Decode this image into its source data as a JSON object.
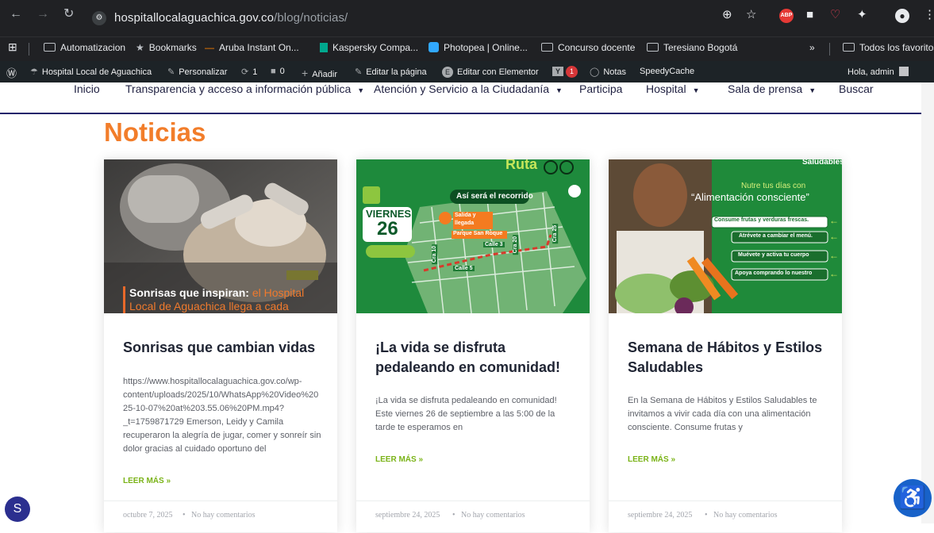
{
  "browser": {
    "url_domain": "hospitallocalaguachica.gov.co",
    "url_path": "/blog/noticias/",
    "back_glyph": "←",
    "forward_glyph": "→",
    "reload_glyph": "↻",
    "site_info_glyph": "⚙",
    "zoom_glyph": "⊕",
    "star_glyph": "☆",
    "abp_label": "ABP",
    "ext1_glyph": "■",
    "pocket_glyph": "♡",
    "puzzle_glyph": "✦",
    "profile_glyph": "●",
    "menu_glyph": "⋮"
  },
  "bookmarks": {
    "apps_glyph": "⊞",
    "items": [
      {
        "label": "Automatizacion"
      },
      {
        "label": "Bookmarks",
        "glyph": "★"
      },
      {
        "label": "Aruba Instant On...",
        "glyph": "—"
      },
      {
        "label": "Kaspersky Compa..."
      },
      {
        "label": "Photopea | Online..."
      },
      {
        "label": "Concurso docente"
      },
      {
        "label": "Teresiano Bogotá"
      }
    ],
    "overflow_glyph": "»",
    "all_label": "Todos los favoritos"
  },
  "wp_admin": {
    "wp_glyph": "Ⓦ",
    "site_glyph": "☂",
    "site_name": "Hospital Local de Aguachica",
    "customize_glyph": "✎",
    "customize": "Personalizar",
    "updates_glyph": "⟳",
    "updates_count": "1",
    "comments_glyph": "■",
    "comments_count": "0",
    "add_glyph": "+",
    "add": "Añadir",
    "edit_glyph": "✎",
    "edit_page": "Editar la página",
    "elementor_glyph": "E",
    "elementor": "Editar con Elementor",
    "yoast_glyph": "Y",
    "yoast_count": "1",
    "notes_glyph": "◯",
    "notes": "Notas",
    "speedy": "SpeedyCache",
    "greeting": "Hola, admin"
  },
  "site_nav": {
    "caret": "▼",
    "items": [
      {
        "label": "Inicio"
      },
      {
        "label": "Transparencia y acceso a información pública"
      },
      {
        "label": "Atención y Servicio a la Ciudadanía"
      },
      {
        "label": "Participa"
      },
      {
        "label": "Hospital"
      },
      {
        "label": "Sala de prensa"
      },
      {
        "label": "Buscar"
      }
    ]
  },
  "page": {
    "title": "Noticias"
  },
  "posts": [
    {
      "title": "Sonrisas que cambian vidas",
      "excerpt": "https://www.hospitallocalaguachica.gov.co/wp-content/uploads/2025/10/WhatsApp%20Video%2025-10-07%20at%203.55.06%20PM.mp4?_t=1759871729 Emerson, Leidy y Camila recuperaron la alegría de jugar, comer y sonreír sin dolor gracias al cuidado oportuno del",
      "read_more": "LEER MÁS »",
      "date": "octubre 7, 2025",
      "comments": "No hay comentarios",
      "thumb_caption_bold": "Sonrisas que inspiran:",
      "thumb_caption_rest": " el Hospital Local de Aguachica llega a cada"
    },
    {
      "title": "¡La vida se disfruta pedaleando en comunidad!",
      "excerpt": "¡La vida se disfruta pedaleando en comunidad! Este viernes 26 de septiembre a las 5:00 de la tarde te esperamos en",
      "read_more": "LEER MÁS »",
      "date": "septiembre 24, 2025",
      "comments": "No hay comentarios",
      "poster": {
        "brand": "Ruta",
        "route_title": "Así será el recorrido",
        "day": "VIERNES",
        "day_num": "26",
        "start": "Salida y llegada",
        "start_place": "Parque San Roque",
        "streets": [
          "Calle 3",
          "Calle 5",
          "Cra 10",
          "Cra 20",
          "Cra 25"
        ]
      }
    },
    {
      "title": "Semana de Hábitos y Estilos Saludables",
      "excerpt": "En la Semana de Hábitos y Estilos Saludables te invitamos a vivir cada día con una alimentación consciente.  Consume frutas y",
      "read_more": "LEER MÁS »",
      "date": "septiembre 24, 2025",
      "comments": "No hay comentarios",
      "poster": {
        "corner": "Saludables",
        "line1": "Nutre tus días con",
        "line2": "“Alimentación consciente”",
        "tips": [
          "Consume frutas y verduras frescas.",
          "Atrévete a cambiar el menú.",
          "Muévete y activa tu cuerpo",
          "Apoya comprando lo nuestro"
        ],
        "arrow": "←"
      }
    }
  ],
  "widgets": {
    "accessibility_glyph": "♿",
    "corner_logo_glyph": "S"
  },
  "meta_separator": "•"
}
